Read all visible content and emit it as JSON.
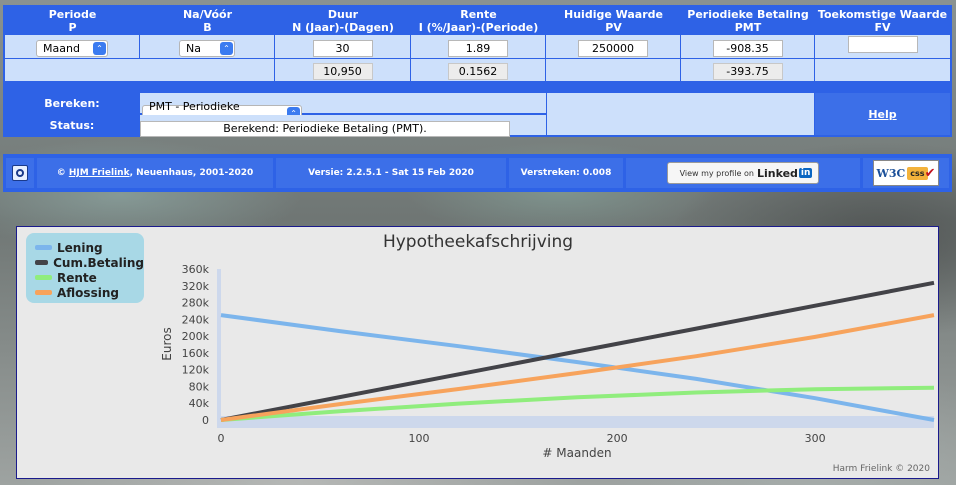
{
  "table": {
    "columns": [
      {
        "line1": "Periode",
        "line2": "P"
      },
      {
        "line1": "Na/Vóór",
        "line2": "B"
      },
      {
        "line1": "Duur",
        "line2": "N (Jaar)-(Dagen)"
      },
      {
        "line1": "Rente",
        "line2": "I (%/Jaar)-(Periode)"
      },
      {
        "line1": "Huidige Waarde",
        "line2": "PV"
      },
      {
        "line1": "Periodieke Betaling",
        "line2": "PMT"
      },
      {
        "line1": "Toekomstige Waarde",
        "line2": "FV"
      }
    ],
    "row1": {
      "periode": "Maand",
      "navoor": "Na",
      "duur": "30",
      "rente": "1.89",
      "pv": "250000",
      "pmt": "-908.35",
      "fv": ""
    },
    "row2": {
      "duur": "10,950",
      "rente": "0.1562",
      "pmt": "-393.75"
    }
  },
  "calc": {
    "bereken_label": "Bereken:",
    "bereken_value": "PMT - Periodieke Betaling",
    "status_label": "Status:",
    "status_value": "Berekend: Periodieke Betaling (PMT).",
    "help_label": "Help"
  },
  "footer": {
    "copyright_symbol": "©",
    "author_link": "HJM Frielink",
    "copyright_rest": ", Neuenhaus, 2001-2020",
    "version": "Versie: 2.2.5.1 - Sat 15 Feb 2020",
    "elapsed": "Verstreken: 0.008",
    "linkedin_text": "View my profile on",
    "linkedin_brand": "Linked",
    "linkedin_in": "in",
    "w3c_text": "W3C",
    "css_text": "css"
  },
  "chart_data": {
    "type": "line",
    "title": "Hypotheekafschrijving",
    "xlabel": "# Maanden",
    "ylabel": "Euros",
    "credit": "Harm Frielink © 2020",
    "xlim": [
      0,
      360
    ],
    "ylim": [
      0,
      360000
    ],
    "x_ticks": [
      0,
      100,
      200,
      300
    ],
    "y_ticks": [
      0,
      40000,
      80000,
      120000,
      160000,
      200000,
      240000,
      280000,
      320000,
      360000
    ],
    "y_tick_labels": [
      "0",
      "40k",
      "80k",
      "120k",
      "160k",
      "200k",
      "240k",
      "280k",
      "320k",
      "360k"
    ],
    "legend_placement": "top-left",
    "x": [
      0,
      60,
      120,
      180,
      240,
      300,
      360
    ],
    "series": [
      {
        "name": "Lening",
        "color": "#7cb5ec",
        "values": [
          250000,
          212000,
          176000,
          138000,
          98000,
          52000,
          0
        ]
      },
      {
        "name": "Cum.Betaling",
        "color": "#434348",
        "values": [
          0,
          54500,
          109000,
          163500,
          218000,
          272500,
          327000
        ]
      },
      {
        "name": "Rente",
        "color": "#90ed7d",
        "values": [
          0,
          21000,
          39000,
          54000,
          65500,
          73500,
          77000
        ]
      },
      {
        "name": "Aflossing",
        "color": "#f7a35c",
        "values": [
          0,
          38000,
          74000,
          112000,
          152000,
          198000,
          250000
        ]
      }
    ]
  }
}
